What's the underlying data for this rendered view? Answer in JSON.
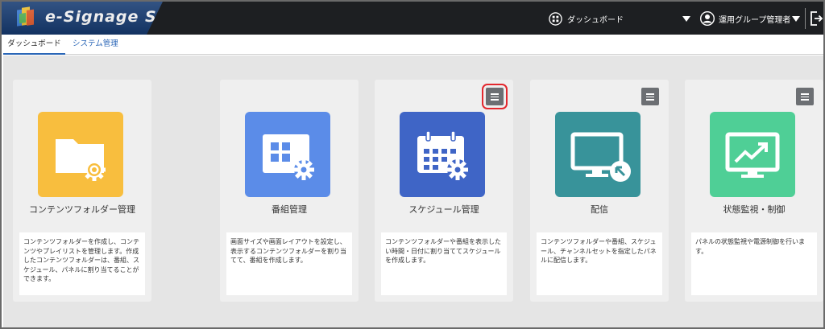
{
  "app": {
    "title": "e-Signage S"
  },
  "header": {
    "dashboard_label": "ダッシュボード",
    "user_label": "運用グループ管理者"
  },
  "tabs": [
    {
      "label": "ダッシュボード",
      "active": true
    },
    {
      "label": "システム管理",
      "active": false
    }
  ],
  "cards": [
    {
      "title": "コンテンツフォルダー管理",
      "icon": "folder-gear-icon",
      "color": "#f8be3e",
      "has_menu": false,
      "description": "コンテンツフォルダーを作成し、コンテンツやプレイリストを管理します。作成したコンテンツフォルダーは、番組、スケジュール、パネルに割り当てることができます。"
    },
    {
      "title": "番組管理",
      "icon": "program-gear-icon",
      "color": "#5b8ce8",
      "has_menu": false,
      "description": "画面サイズや画面レイアウトを設定し、表示するコンテンツフォルダーを割り当てて、番組を作成します。"
    },
    {
      "title": "スケジュール管理",
      "icon": "calendar-gear-icon",
      "color": "#3f65c6",
      "has_menu": true,
      "menu_highlighted": true,
      "description": "コンテンツフォルダーや番組を表示したい時間・日付に割り当ててスケジュールを作成します。"
    },
    {
      "title": "配信",
      "icon": "monitor-deliver-icon",
      "color": "#38939a",
      "has_menu": true,
      "description": "コンテンツフォルダーや番組、スケジュール、チャンネルセットを指定したパネルに配信します。"
    },
    {
      "title": "状態監視・制御",
      "icon": "monitor-chart-icon",
      "color": "#4fcf96",
      "has_menu": true,
      "description": "パネルの状態監視や電源制御を行います。"
    }
  ],
  "colors": {
    "header_bg": "#1d1f22",
    "logo_bg": "#163b72",
    "accent": "#2a66b7",
    "highlight": "#e3282e"
  }
}
